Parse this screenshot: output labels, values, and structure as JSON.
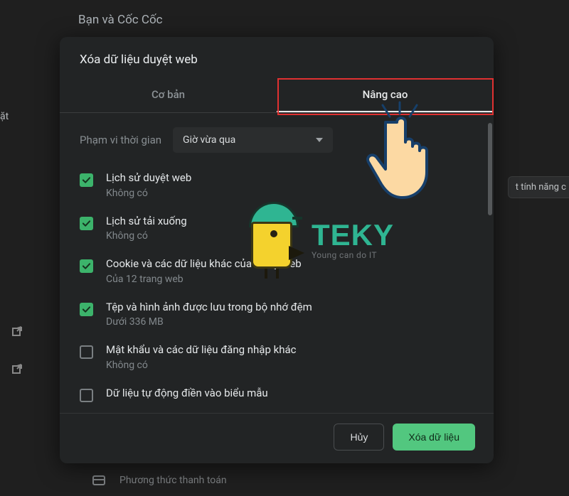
{
  "page": {
    "section_title": "Bạn và Cốc Cốc",
    "sidebar_truncated": "ặt",
    "right_pill": "t tính năng c",
    "footer_item": "Phương thức thanh toán"
  },
  "modal": {
    "title": "Xóa dữ liệu duyệt web",
    "tabs": {
      "basic": "Cơ bản",
      "advanced": "Nâng cao"
    },
    "time": {
      "label": "Phạm vi thời gian",
      "selected": "Giờ vừa qua"
    },
    "items": [
      {
        "checked": true,
        "title": "Lịch sử duyệt web",
        "subtitle": "Không có"
      },
      {
        "checked": true,
        "title": "Lịch sử tải xuống",
        "subtitle": "Không có"
      },
      {
        "checked": true,
        "title": "Cookie và các dữ liệu khác của trang web",
        "subtitle": "Của 12 trang web"
      },
      {
        "checked": true,
        "title": "Tệp và hình ảnh được lưu trong bộ nhớ đệm",
        "subtitle": "Dưới 336 MB"
      },
      {
        "checked": false,
        "title": "Mật khẩu và các dữ liệu đăng nhập khác",
        "subtitle": "Không có"
      },
      {
        "checked": false,
        "title": "Dữ liệu tự động điền vào biểu mẫu",
        "subtitle": ""
      }
    ],
    "buttons": {
      "cancel": "Hủy",
      "confirm": "Xóa dữ liệu"
    }
  },
  "overlay": {
    "logo_brand": "TEKY",
    "logo_tagline": "Young can do IT"
  }
}
